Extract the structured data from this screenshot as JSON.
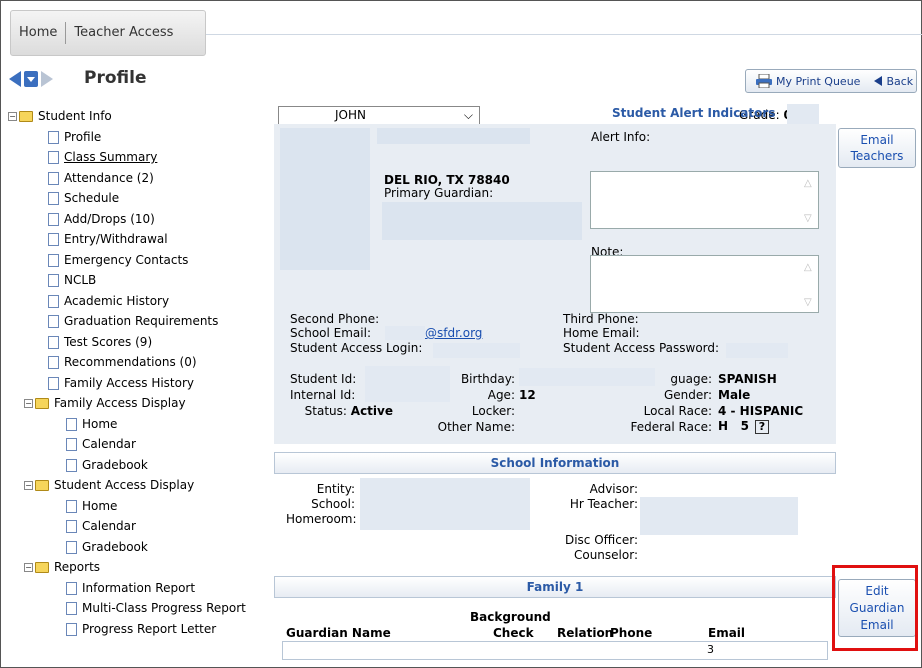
{
  "tabs": [
    "Home",
    "Teacher Access"
  ],
  "page_title": "Profile",
  "toolbar": {
    "print_queue": "My Print Queue",
    "back": "Back"
  },
  "tree": {
    "student_info": "Student Info",
    "student_info_items": [
      "Profile",
      "Class Summary",
      "Attendance (2)",
      "Schedule",
      "Add/Drops (10)",
      "Entry/Withdrawal",
      "Emergency Contacts",
      "NCLB",
      "Academic History",
      "Graduation Requirements",
      "Test Scores (9)",
      "Recommendations (0)",
      "Family Access History"
    ],
    "family_access_display": "Family Access Display",
    "family_items": [
      "Home",
      "Calendar",
      "Gradebook"
    ],
    "student_access_display": "Student Access Display",
    "student_items": [
      "Home",
      "Calendar",
      "Gradebook"
    ],
    "reports": "Reports",
    "report_items": [
      "Information Report",
      "Multi-Class Progress Report",
      "Progress Report Letter"
    ]
  },
  "student_select": {
    "value": "JOHN"
  },
  "grade": {
    "label": "Grade:",
    "value": "05"
  },
  "alerts": {
    "title": "Student Alert Indicators",
    "alert_info": "Alert Info:",
    "note": "Note:"
  },
  "address": {
    "city": "DEL RIO, TX 78840",
    "guardian": "Primary Guardian:"
  },
  "buttons": {
    "email_teachers": [
      "Email",
      "Teachers"
    ],
    "edit_guardian": [
      "Edit",
      "Guardian",
      "Email"
    ]
  },
  "contact": {
    "second_phone": "Second Phone:",
    "third_phone": "Third Phone:",
    "school_email": "School Email:",
    "school_email_val": "@sfdr.org",
    "home_email": "Home Email:",
    "sa_login": "Student Access Login:",
    "sa_password": "Student Access Password:"
  },
  "ids": {
    "student_id": "Student Id:",
    "internal_id": "Internal Id:",
    "status": "Status:",
    "status_val": "Active",
    "birthday": "Birthday:",
    "age": "Age:",
    "age_val": "12",
    "locker": "Locker:",
    "other_name": "Other Name:",
    "language": "guage:",
    "language_val": "SPANISH",
    "gender": "Gender:",
    "gender_val": "Male",
    "local_race": "Local Race:",
    "local_race_val": "4 - HISPANIC",
    "federal_race": "Federal Race:",
    "federal_race_val": "H   5",
    "help": "?"
  },
  "school_info": {
    "title": "School Information",
    "entity": "Entity:",
    "school": "School:",
    "homeroom": "Homeroom:",
    "advisor": "Advisor:",
    "hr_teacher": "Hr Teacher:",
    "disc_officer": "Disc Officer:",
    "counselor": "Counselor:"
  },
  "family": {
    "title": "Family 1",
    "cols": [
      "Guardian Name",
      "Background",
      "Check",
      "Relation",
      "Phone",
      "Email"
    ],
    "row_fragment": "3"
  },
  "colors": {
    "accent": "#2b5aa6",
    "highlight": "#e01010",
    "panel": "#e8edf3"
  }
}
